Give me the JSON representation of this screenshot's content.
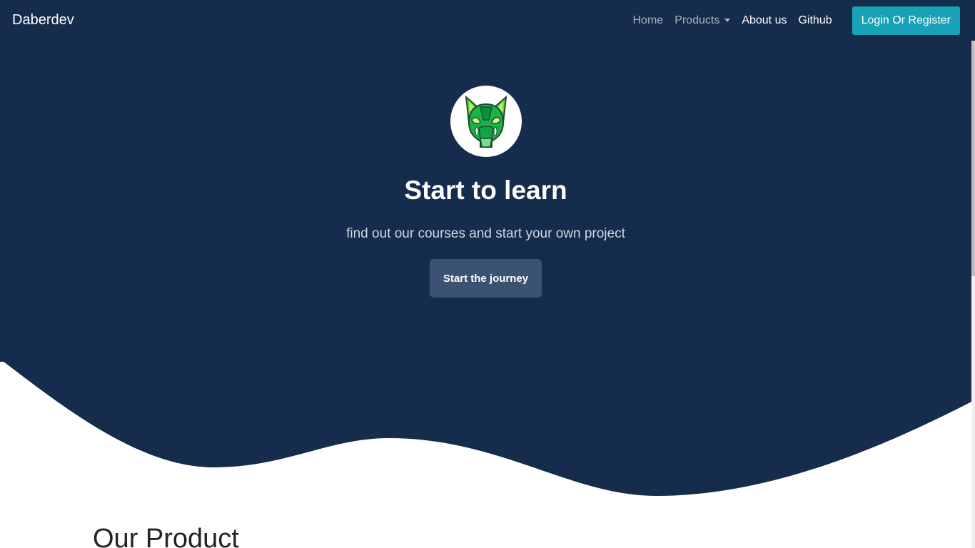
{
  "nav": {
    "brand": "Daberdev",
    "links": [
      {
        "label": "Home"
      },
      {
        "label": "Products"
      },
      {
        "label": "About us"
      },
      {
        "label": "Github"
      }
    ],
    "login_label": "Login Or Register"
  },
  "hero": {
    "title": "Start to learn",
    "subtitle": "find out our courses and start your own project",
    "cta_label": "Start the journey",
    "logo_icon": "green-cat-head-logo"
  },
  "section": {
    "title": "Our Product"
  },
  "colors": {
    "navy": "#152c4d",
    "accent": "#17a2b8",
    "button": "#3b5272"
  }
}
